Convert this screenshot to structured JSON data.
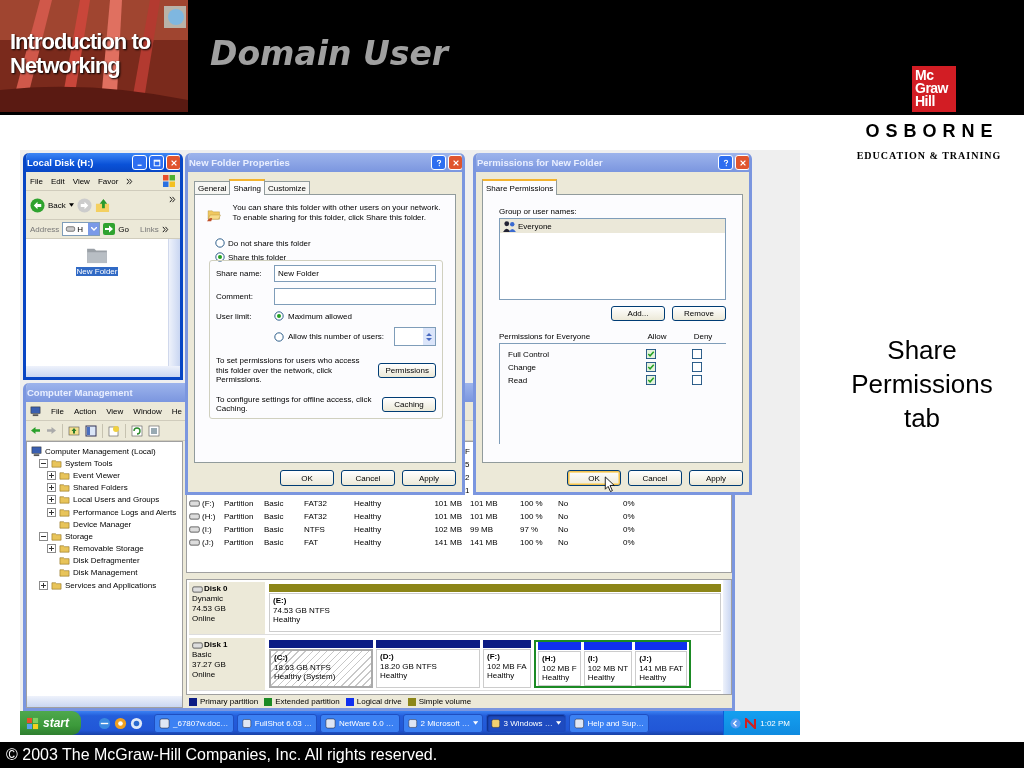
{
  "slide": {
    "logo_lines": [
      "Introduction to",
      "Networking"
    ],
    "title": "Domain User",
    "publisher_mark": [
      "Mc",
      "Graw",
      "Hill"
    ],
    "publisher_name": "OSBORNE",
    "publisher_tagline": "EDUCATION & TRAINING",
    "caption": "Share Permissions tab",
    "copyright": "© 2003 The McGraw-Hill Companies, Inc. All rights reserved."
  },
  "explorer": {
    "title": "Local Disk (H:)",
    "active": true,
    "menu": [
      "File",
      "Edit",
      "View",
      "Favor"
    ],
    "back": "Back",
    "address_label": "Address",
    "address_value": "H",
    "go": "Go",
    "links": "Links",
    "items": [
      {
        "label": "New Folder",
        "selected": true
      }
    ]
  },
  "properties": {
    "title": "New Folder Properties",
    "active": false,
    "tabs": [
      {
        "label": "General",
        "selected": false
      },
      {
        "label": "Sharing",
        "selected": true
      },
      {
        "label": "Customize",
        "selected": false
      }
    ],
    "intro": "You can share this folder with other users on your network.  To enable sharing for this folder, click Share this folder.",
    "share_options": [
      {
        "label": "Do not share this folder",
        "selected": false
      },
      {
        "label": "Share this folder",
        "selected": true
      }
    ],
    "share_name_label": "Share name:",
    "share_name": "New Folder",
    "comment_label": "Comment:",
    "user_limit_label": "User limit:",
    "limit_options": [
      {
        "label": "Maximum allowed",
        "selected": true
      },
      {
        "label": "Allow this number of users:",
        "selected": false
      }
    ],
    "permissions_text": "To set permissions for users who access this folder over the network, click Permissions.",
    "permissions_button": "Permissions",
    "caching_text": "To configure settings for offline access, click Caching.",
    "caching_button": "Caching",
    "buttons": [
      "OK",
      "Cancel",
      "Apply"
    ]
  },
  "permissions": {
    "title": "Permissions for New Folder",
    "active": false,
    "tabs": [
      {
        "label": "Share Permissions",
        "selected": true
      }
    ],
    "group_label": "Group or user names:",
    "users": [
      {
        "name": "Everyone",
        "selected": true
      }
    ],
    "add": "Add...",
    "remove": "Remove",
    "perm_label": "Permissions for Everyone",
    "allow_label": "Allow",
    "deny_label": "Deny",
    "perms": [
      {
        "name": "Full Control",
        "allow": true,
        "deny": false
      },
      {
        "name": "Change",
        "allow": true,
        "deny": false
      },
      {
        "name": "Read",
        "allow": true,
        "deny": false
      }
    ],
    "buttons": [
      {
        "label": "OK",
        "focused": true
      },
      {
        "label": "Cancel",
        "focused": false
      },
      {
        "label": "Apply",
        "focused": false
      }
    ]
  },
  "computer_management": {
    "title": "Computer Management",
    "active": false,
    "menu": [
      "File",
      "Action",
      "View",
      "Window",
      "He"
    ],
    "tree": {
      "label": "Computer Management (Local)",
      "children": [
        {
          "label": "System Tools",
          "expanded": true,
          "children": [
            {
              "label": "Event Viewer",
              "expanded": false
            },
            {
              "label": "Shared Folders",
              "expanded": false
            },
            {
              "label": "Local Users and Groups",
              "expanded": false
            },
            {
              "label": "Performance Logs and Alerts",
              "expanded": false
            },
            {
              "label": "Device Manager"
            }
          ]
        },
        {
          "label": "Storage",
          "expanded": true,
          "children": [
            {
              "label": "Removable Storage",
              "expanded": false
            },
            {
              "label": "Disk Defragmenter"
            },
            {
              "label": "Disk Management"
            }
          ]
        },
        {
          "label": "Services and Applications",
          "expanded": false
        }
      ]
    },
    "column_fragment": "F",
    "cell_fragments": [
      "5",
      "2",
      "1"
    ],
    "volumes": [
      {
        "name": "(F:)",
        "layout": "Partition",
        "type": "Basic",
        "fs": "FAT32",
        "status": "Healthy",
        "capacity": "101 MB",
        "free": "101 MB",
        "pct": "100 %",
        "fault": "No",
        "overhead": "0%"
      },
      {
        "name": "(H:)",
        "layout": "Partition",
        "type": "Basic",
        "fs": "FAT32",
        "status": "Healthy",
        "capacity": "101 MB",
        "free": "101 MB",
        "pct": "100 %",
        "fault": "No",
        "overhead": "0%"
      },
      {
        "name": "(I:)",
        "layout": "Partition",
        "type": "Basic",
        "fs": "NTFS",
        "status": "Healthy",
        "capacity": "102 MB",
        "free": "99 MB",
        "pct": "97 %",
        "fault": "No",
        "overhead": "0%"
      },
      {
        "name": "(J:)",
        "layout": "Partition",
        "type": "Basic",
        "fs": "FAT",
        "status": "Healthy",
        "capacity": "141 MB",
        "free": "141 MB",
        "pct": "100 %",
        "fault": "No",
        "overhead": "0%"
      }
    ],
    "disks": [
      {
        "name": "Disk 0",
        "type": "Dynamic",
        "size": "74.53 GB",
        "state": "Online",
        "parts": [
          {
            "letter": "(E:)",
            "size": "74.53 GB NTFS",
            "status": "Healthy",
            "kind": "simple",
            "selected": false
          }
        ]
      },
      {
        "name": "Disk 1",
        "type": "Basic",
        "size": "37.27 GB",
        "state": "Online",
        "parts": [
          {
            "letter": "(C:)",
            "size": "18.63 GB NTFS",
            "status": "Healthy (System)",
            "kind": "primary",
            "selected": true
          },
          {
            "letter": "(D:)",
            "size": "18.20 GB NTFS",
            "status": "Healthy",
            "kind": "primary",
            "selected": false
          },
          {
            "letter": "(F:)",
            "size": "102 MB FA",
            "status": "Healthy",
            "kind": "primary",
            "selected": false
          },
          {
            "letter": "(H:)",
            "size": "102 MB F",
            "status": "Healthy",
            "kind": "logical",
            "selected": false
          },
          {
            "letter": "(I:)",
            "size": "102 MB NT",
            "status": "Healthy",
            "kind": "logical",
            "selected": false
          },
          {
            "letter": "(J:)",
            "size": "141 MB FAT",
            "status": "Healthy",
            "kind": "logical",
            "selected": false
          }
        ]
      }
    ],
    "legend": [
      {
        "label": "Primary partition",
        "color": "#0c1c84"
      },
      {
        "label": "Extended partition",
        "color": "#1b8a24"
      },
      {
        "label": "Logical drive",
        "color": "#1030f0"
      },
      {
        "label": "Simple volume",
        "color": "#8c8618"
      }
    ]
  },
  "taskbar": {
    "start": "start",
    "tasks": [
      {
        "label": "_67807w.doc…",
        "selected": false,
        "grouped": false
      },
      {
        "label": "FullShot 6.03 …",
        "selected": false,
        "grouped": false
      },
      {
        "label": "NetWare 6.0 …",
        "selected": false,
        "grouped": false
      },
      {
        "label": "2 Microsoft …",
        "selected": false,
        "grouped": true
      },
      {
        "label": "3 Windows …",
        "selected": true,
        "grouped": true
      },
      {
        "label": "Help and Sup…",
        "selected": false,
        "grouped": false
      }
    ],
    "clock": "1:02 PM"
  }
}
